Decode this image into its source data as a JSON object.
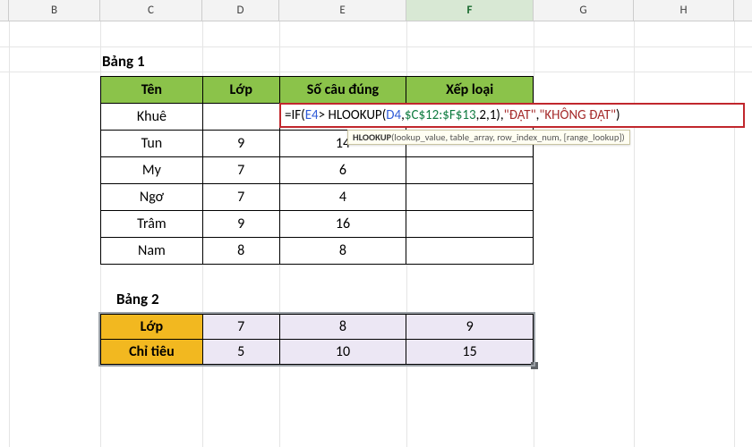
{
  "columns": [
    "B",
    "C",
    "D",
    "E",
    "F",
    "G",
    "H"
  ],
  "activeColumn": "F",
  "colWidths": {
    "spacer": 10,
    "B": 102,
    "C": 114,
    "D": 86,
    "E": 142,
    "F": 142,
    "G": 112,
    "H": 112
  },
  "bang1": {
    "title": "Bảng 1",
    "headers": [
      "Tên",
      "Lớp",
      "Số câu đúng",
      "Xếp loại"
    ],
    "rows": [
      {
        "ten": "Khuê",
        "lop": "",
        "socau": "",
        "xeploai": ""
      },
      {
        "ten": "Tun",
        "lop": "9",
        "socau": "14",
        "xeploai": ""
      },
      {
        "ten": "My",
        "lop": "7",
        "socau": "6",
        "xeploai": ""
      },
      {
        "ten": "Ngơ",
        "lop": "7",
        "socau": "4",
        "xeploai": ""
      },
      {
        "ten": "Trâm",
        "lop": "9",
        "socau": "16",
        "xeploai": ""
      },
      {
        "ten": "Nam",
        "lop": "8",
        "socau": "8",
        "xeploai": ""
      }
    ]
  },
  "bang2": {
    "title": "Bảng 2",
    "rows": [
      {
        "label": "Lớp",
        "v1": "7",
        "v2": "8",
        "v3": "9"
      },
      {
        "label": "Chỉ tiêu",
        "v1": "5",
        "v2": "10",
        "v3": "15"
      }
    ]
  },
  "formula": {
    "eq": "=",
    "if": "IF",
    "op": "(",
    "e4": "E4",
    "gt": ">",
    "sp": " ",
    "hl": "HLOOKUP",
    "op2": "(",
    "d4": "D4",
    "c1": ",",
    "rng": "$C$12:$F$13",
    "c2": ",",
    "n2": "2",
    "c3": ",",
    "n1": "1",
    "cp": ")",
    "c4": ",",
    "s1": "\"ĐẠT\"",
    "c5": ",",
    "s2": "\"KHÔNG ĐẠT\"",
    "cp2": ")"
  },
  "tooltip": {
    "fn": "HLOOKUP",
    "args": "(lookup_value, table_array, row_index_num, [range_lookup])"
  }
}
